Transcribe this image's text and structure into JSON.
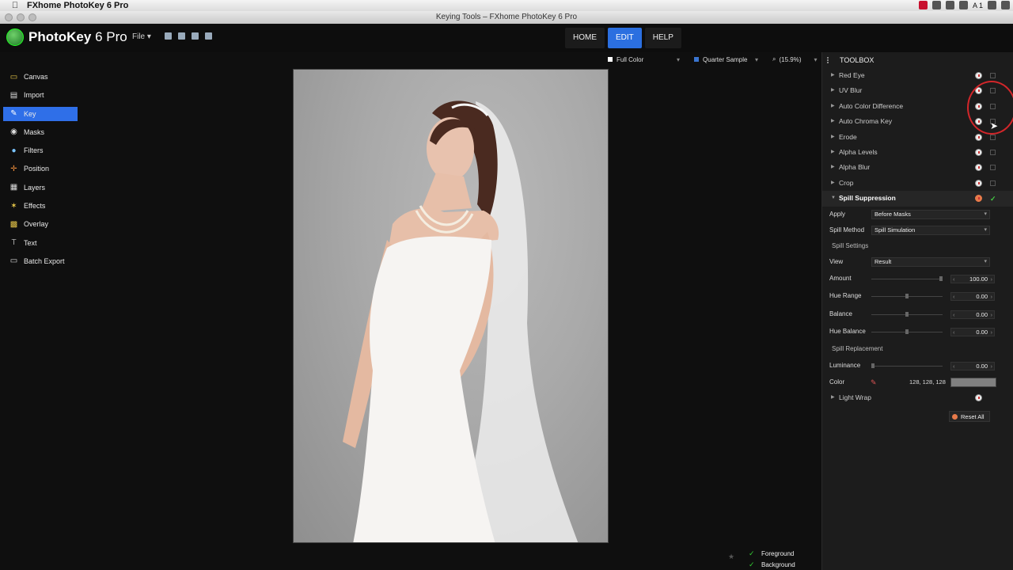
{
  "menubar": {
    "app_name": "FXhome PhotoKey 6 Pro",
    "tray_text": "A 1"
  },
  "window": {
    "title": "Keying Tools – FXhome PhotoKey 6 Pro"
  },
  "toolbar": {
    "logo_text": "PhotoKey",
    "logo_version": "6 Pro",
    "file_menu": "File ▾",
    "nav": [
      {
        "label": "HOME",
        "active": false
      },
      {
        "label": "EDIT",
        "active": true
      },
      {
        "label": "HELP",
        "active": false
      }
    ]
  },
  "sidebar": {
    "items": [
      {
        "label": "Canvas",
        "icon": "canvas-icon",
        "glyph": "▭",
        "color": "#e8c84a"
      },
      {
        "label": "Import",
        "icon": "import-icon",
        "glyph": "▤",
        "color": "#dddddd"
      },
      {
        "label": "Key",
        "icon": "key-icon",
        "glyph": "✎",
        "color": "#ffffff"
      },
      {
        "label": "Masks",
        "icon": "masks-icon",
        "glyph": "◉",
        "color": "#dddddd"
      },
      {
        "label": "Filters",
        "icon": "filters-icon",
        "glyph": "●",
        "color": "#7ac4ff"
      },
      {
        "label": "Position",
        "icon": "position-icon",
        "glyph": "✛",
        "color": "#e88a3a"
      },
      {
        "label": "Layers",
        "icon": "layers-icon",
        "glyph": "▦",
        "color": "#dddddd"
      },
      {
        "label": "Effects",
        "icon": "effects-icon",
        "glyph": "✶",
        "color": "#e8c84a"
      },
      {
        "label": "Overlay",
        "icon": "overlay-icon",
        "glyph": "▩",
        "color": "#e8c84a"
      },
      {
        "label": "Text",
        "icon": "text-icon",
        "glyph": "T",
        "color": "#aaaaaa"
      },
      {
        "label": "Batch Export",
        "icon": "batch-export-icon",
        "glyph": "▭",
        "color": "#dddddd"
      }
    ],
    "active_index": 2
  },
  "viewer": {
    "mode": "Full Color",
    "sample": "Quarter Sample",
    "zoom": "(15.9%)"
  },
  "layers": {
    "items": [
      "Foreground",
      "Background"
    ]
  },
  "toolbox": {
    "title": "TOOLBOX",
    "tools": [
      "Red Eye",
      "UV Blur",
      "Auto Color Difference",
      "Auto Chroma Key",
      "Erode",
      "Alpha Levels",
      "Alpha Blur",
      "Crop"
    ],
    "open_tool": "Spill Suppression",
    "apply_label": "Apply",
    "apply_value": "Before Masks",
    "method_label": "Spill Method",
    "method_value": "Spill Simulation",
    "settings_section": "Spill Settings",
    "view_label": "View",
    "view_value": "Result",
    "sliders": [
      {
        "label": "Amount",
        "value": "100.00",
        "pos": 1.0
      },
      {
        "label": "Hue Range",
        "value": "0.00",
        "pos": 0.5
      },
      {
        "label": "Balance",
        "value": "0.00",
        "pos": 0.5
      },
      {
        "label": "Hue Balance",
        "value": "0.00",
        "pos": 0.5
      }
    ],
    "replacement_section": "Spill Replacement",
    "luminance": {
      "label": "Luminance",
      "value": "0.00",
      "pos": 0.0
    },
    "color_label": "Color",
    "color_rgb": "128, 128, 128",
    "color_hex": "#808080",
    "after_tool": "Light Wrap",
    "reset_label": "Reset All"
  }
}
